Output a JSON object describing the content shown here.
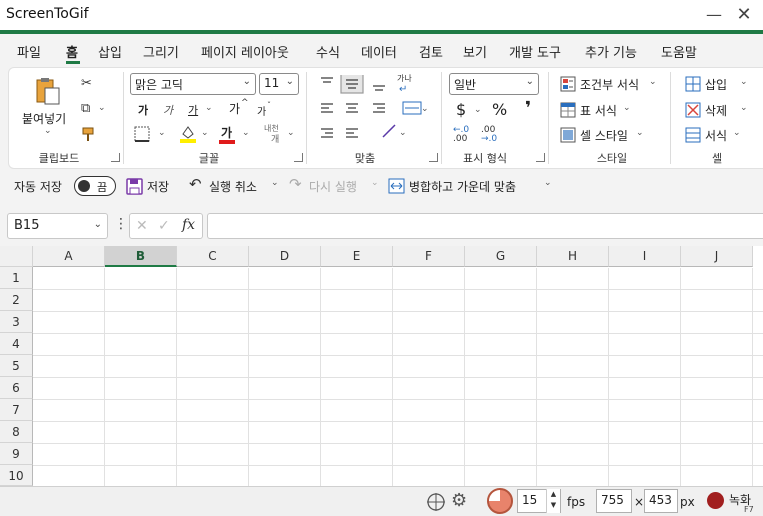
{
  "window": {
    "title": "ScreenToGif",
    "minimize_glyph": "—",
    "close_glyph": "✕"
  },
  "tabs": [
    "파일",
    "홈",
    "삽입",
    "그리기",
    "페이지 레이아웃",
    "수식",
    "데이터",
    "검토",
    "보기",
    "개발 도구",
    "추가 기능",
    "도움말"
  ],
  "active_tab": "홈",
  "ribbon": {
    "clipboard": {
      "paste_label": "붙여넣기",
      "group_label": "클립보드"
    },
    "font": {
      "font_name": "맑은 고딕",
      "font_size": "11",
      "bold": "가",
      "italic": "가",
      "underline": "가",
      "grow": "가",
      "shrink": "가",
      "font_color_letter": "가",
      "phonetic_top": "내천",
      "phonetic_bottom": "개",
      "group_label": "글꼴",
      "highlight_color": "#ffef00",
      "font_color": "#e01b1b"
    },
    "alignment": {
      "group_label": "맞춤"
    },
    "number": {
      "format": "일반",
      "currency": "$",
      "percent": "%",
      "comma": "❜",
      "group_label": "표시 형식"
    },
    "styles": {
      "conditional": "조건부 서식",
      "table": "표 서식",
      "cell": "셀 스타일",
      "group_label": "스타일"
    },
    "cells": {
      "insert": "삽입",
      "delete": "삭제",
      "format": "서식",
      "group_label": "셀"
    }
  },
  "quick_access": {
    "autosave_label": "자동 저장",
    "toggle_state": "끔",
    "save": "저장",
    "undo": "실행 취소",
    "redo": "다시 실행",
    "merge": "병합하고 가운데 맞춤"
  },
  "formula_bar": {
    "name_box": "B15",
    "fx": "fx",
    "value": ""
  },
  "sheet": {
    "columns": [
      "A",
      "B",
      "C",
      "D",
      "E",
      "F",
      "G",
      "H",
      "I",
      "J"
    ],
    "rows": [
      "1",
      "2",
      "3",
      "4",
      "5",
      "6",
      "7",
      "8",
      "9",
      "10"
    ],
    "selected_column": "B"
  },
  "recorder": {
    "fps_value": "15",
    "fps_unit": "fps",
    "width": "755",
    "times": "×",
    "height": "453",
    "px_unit": "px",
    "record_label": "녹화",
    "record_shortcut": "F7",
    "accent_color": "#a11f1f"
  }
}
